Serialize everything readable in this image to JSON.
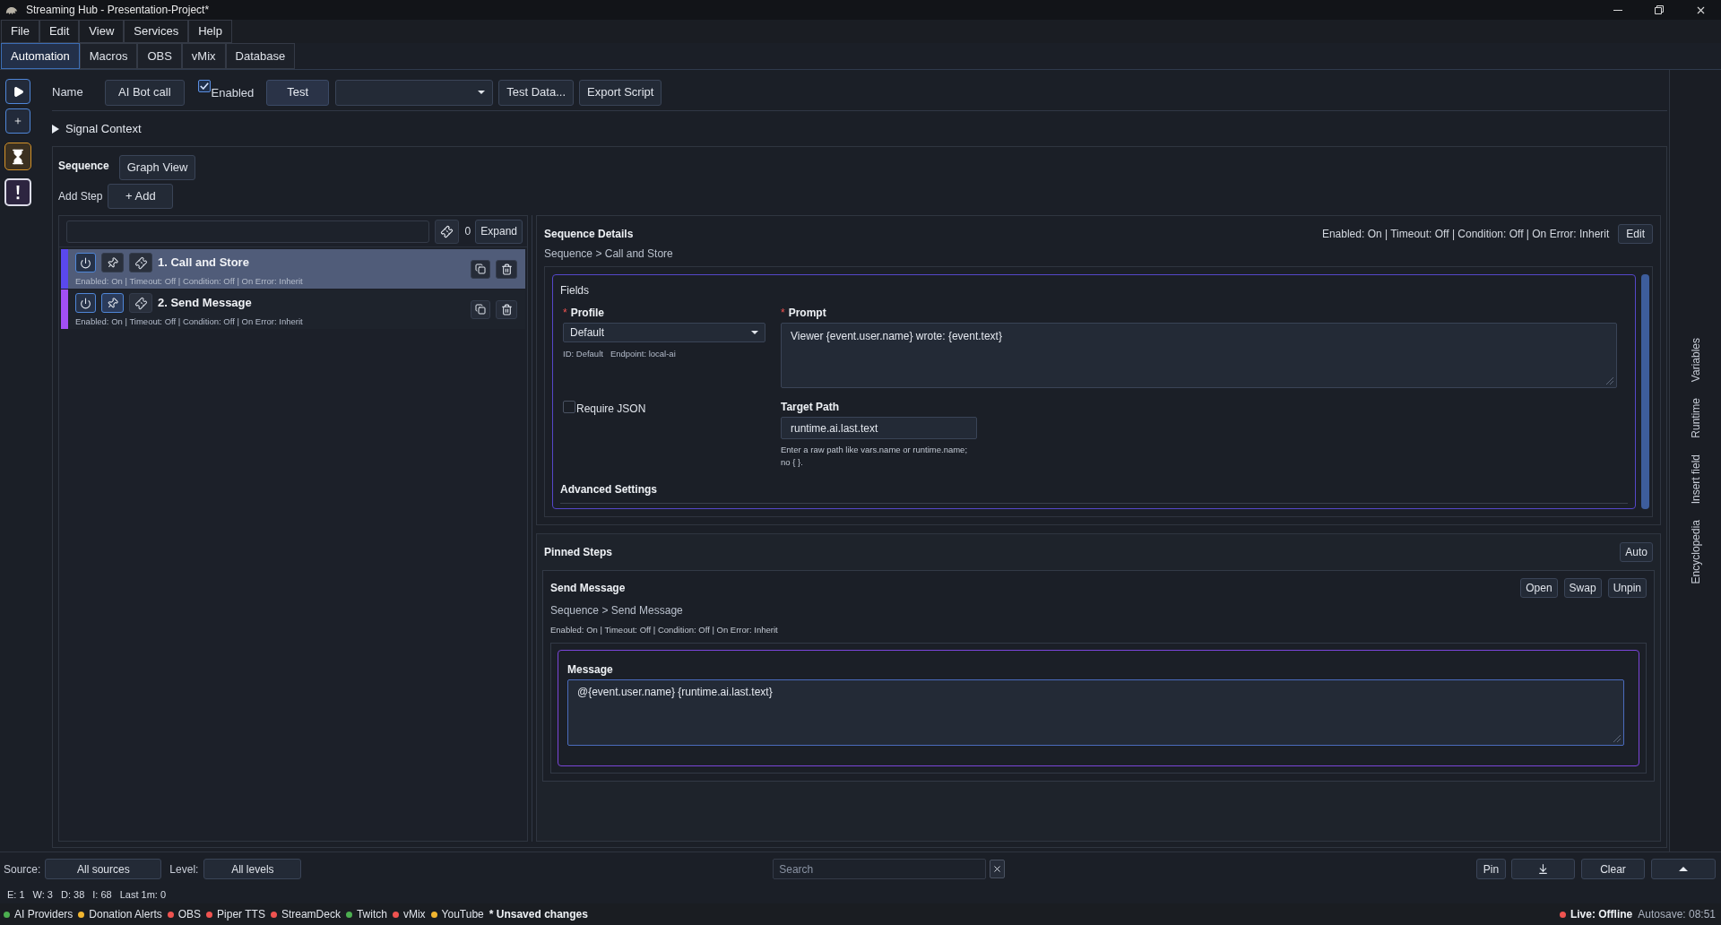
{
  "window": {
    "title": "Streaming Hub - Presentation-Project*"
  },
  "menu": [
    "File",
    "Edit",
    "View",
    "Services",
    "Help"
  ],
  "tabs": [
    {
      "label": "Automation",
      "selected": true
    },
    {
      "label": "Macros",
      "selected": false
    },
    {
      "label": "OBS",
      "selected": false
    },
    {
      "label": "vMix",
      "selected": false
    },
    {
      "label": "Database",
      "selected": false
    }
  ],
  "toolbar": {
    "name_label": "Name",
    "name_value": "AI Bot call",
    "enabled": {
      "label": "Enabled",
      "checked": true
    },
    "test": "Test",
    "buttons": [
      "Test Data...",
      "Export Script"
    ]
  },
  "signal_context": {
    "label": "Signal Context",
    "expanded": false
  },
  "sequence": {
    "title": "Sequence",
    "graph_view": "Graph View",
    "add_step_label": "Add Step",
    "add_button": "+ Add"
  },
  "step_list": {
    "count": "0",
    "expand": "Expand",
    "steps": [
      {
        "title": "1. Call and Store",
        "summary": "Enabled: On | Timeout: Off | Condition: Off | On Error: Inherit",
        "selected": true,
        "color": "#5a48ee",
        "enabled": true,
        "pinned": false
      },
      {
        "title": "2. Send Message",
        "summary": "Enabled: On | Timeout: Off | Condition: Off | On Error: Inherit",
        "selected": false,
        "color": "#a24ff5",
        "enabled": true,
        "pinned": true
      }
    ]
  },
  "details": {
    "title": "Sequence Details",
    "breadcrumb": "Sequence > Call and Store",
    "status": "Enabled: On | Timeout: Off | Condition: Off | On Error: Inherit",
    "edit": "Edit",
    "fields": {
      "title": "Fields",
      "profile": {
        "required_mark": "*",
        "label": "Profile",
        "value": "Default",
        "info": [
          "ID: Default",
          "Endpoint: local-ai"
        ]
      },
      "prompt": {
        "required_mark": "*",
        "label": "Prompt",
        "value": "Viewer {event.user.name} wrote: {event.text}"
      },
      "require_json": {
        "label": "Require JSON",
        "checked": false
      },
      "target_path": {
        "label": "Target Path",
        "value": "runtime.ai.last.text",
        "help": "Enter a raw path like vars.name or runtime.name; no { }."
      },
      "advanced": "Advanced Settings"
    }
  },
  "pinned": {
    "title": "Pinned Steps",
    "auto": "Auto",
    "steps": [
      {
        "title": "Send Message",
        "breadcrumb": "Sequence > Send Message",
        "status": "Enabled: On | Timeout: Off | Condition: Off | On Error: Inherit",
        "actions": [
          "Open",
          "Swap",
          "Unpin"
        ],
        "field": {
          "label": "Message",
          "value": "@{event.user.name} {runtime.ai.last.text}"
        }
      }
    ]
  },
  "side_tabs": [
    "Variables",
    "Runtime",
    "Insert field",
    "Encyclopedia"
  ],
  "log": {
    "source_label": "Source:",
    "source": "All sources",
    "level_label": "Level:",
    "level": "All levels",
    "search_placeholder": "Search",
    "pin": "Pin",
    "clear": "Clear",
    "stats": [
      "E: 1",
      "W: 3",
      "D: 38",
      "I: 68",
      "Last 1m: 0"
    ]
  },
  "status_bar": {
    "services": [
      {
        "name": "AI Providers",
        "color": "#4caf50"
      },
      {
        "name": "Donation Alerts",
        "color": "#f2b630"
      },
      {
        "name": "OBS",
        "color": "#ef5350"
      },
      {
        "name": "Piper TTS",
        "color": "#ef5350"
      },
      {
        "name": "StreamDeck",
        "color": "#ef5350"
      },
      {
        "name": "Twitch",
        "color": "#4caf50"
      },
      {
        "name": "vMix",
        "color": "#ef5350"
      },
      {
        "name": "YouTube",
        "color": "#f2b630"
      }
    ],
    "unsaved": "* Unsaved changes",
    "live": {
      "label": "Live: Offline",
      "color": "#ef5350"
    },
    "autosave": "Autosave: 08:51"
  }
}
